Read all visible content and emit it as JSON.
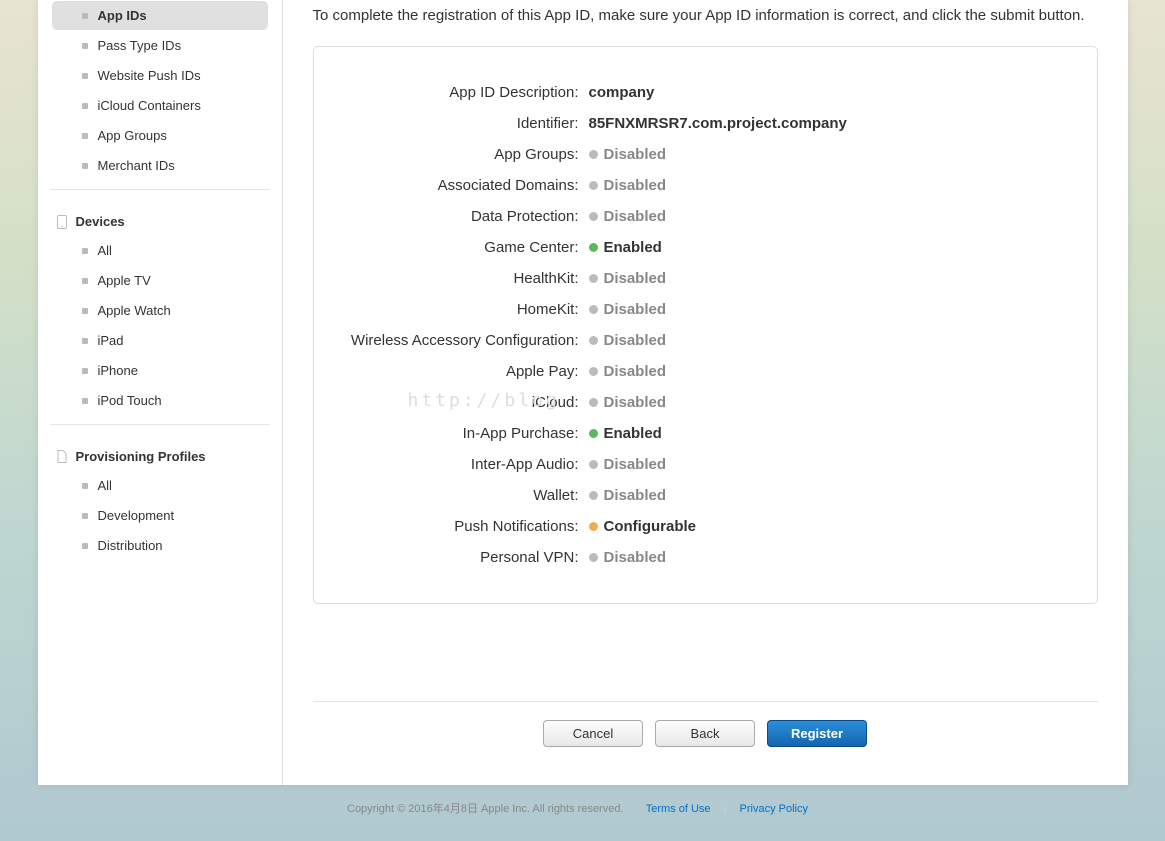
{
  "instruction": "To complete the registration of this App ID, make sure your App ID information is correct, and click the submit button.",
  "sidebar": {
    "identifiers": {
      "items": [
        {
          "label": "App IDs",
          "active": true
        },
        {
          "label": "Pass Type IDs",
          "active": false
        },
        {
          "label": "Website Push IDs",
          "active": false
        },
        {
          "label": "iCloud Containers",
          "active": false
        },
        {
          "label": "App Groups",
          "active": false
        },
        {
          "label": "Merchant IDs",
          "active": false
        }
      ]
    },
    "devices": {
      "heading": "Devices",
      "items": [
        {
          "label": "All"
        },
        {
          "label": "Apple TV"
        },
        {
          "label": "Apple Watch"
        },
        {
          "label": "iPad"
        },
        {
          "label": "iPhone"
        },
        {
          "label": "iPod Touch"
        }
      ]
    },
    "profiles": {
      "heading": "Provisioning Profiles",
      "items": [
        {
          "label": "All"
        },
        {
          "label": "Development"
        },
        {
          "label": "Distribution"
        }
      ]
    }
  },
  "summary": {
    "description_label": "App ID Description:",
    "description_value": "company",
    "identifier_label": "Identifier:",
    "identifier_value": "85FNXMRSR7.com.project.company",
    "services": [
      {
        "label": "App Groups:",
        "status": "Disabled",
        "dot": "gray"
      },
      {
        "label": "Associated Domains:",
        "status": "Disabled",
        "dot": "gray"
      },
      {
        "label": "Data Protection:",
        "status": "Disabled",
        "dot": "gray"
      },
      {
        "label": "Game Center:",
        "status": "Enabled",
        "dot": "green"
      },
      {
        "label": "HealthKit:",
        "status": "Disabled",
        "dot": "gray"
      },
      {
        "label": "HomeKit:",
        "status": "Disabled",
        "dot": "gray"
      },
      {
        "label": "Wireless Accessory Configuration:",
        "status": "Disabled",
        "dot": "gray"
      },
      {
        "label": "Apple Pay:",
        "status": "Disabled",
        "dot": "gray"
      },
      {
        "label": "iCloud:",
        "status": "Disabled",
        "dot": "gray"
      },
      {
        "label": "In-App Purchase:",
        "status": "Enabled",
        "dot": "green"
      },
      {
        "label": "Inter-App Audio:",
        "status": "Disabled",
        "dot": "gray"
      },
      {
        "label": "Wallet:",
        "status": "Disabled",
        "dot": "gray"
      },
      {
        "label": "Push Notifications:",
        "status": "Configurable",
        "dot": "orange"
      },
      {
        "label": "Personal VPN:",
        "status": "Disabled",
        "dot": "gray"
      }
    ]
  },
  "buttons": {
    "cancel": "Cancel",
    "back": "Back",
    "register": "Register"
  },
  "footer": {
    "copyright": "Copyright © 2016年4月8日 Apple Inc. All rights reserved.",
    "terms": "Terms of Use",
    "privacy": "Privacy Policy"
  },
  "watermark": "http://blog"
}
